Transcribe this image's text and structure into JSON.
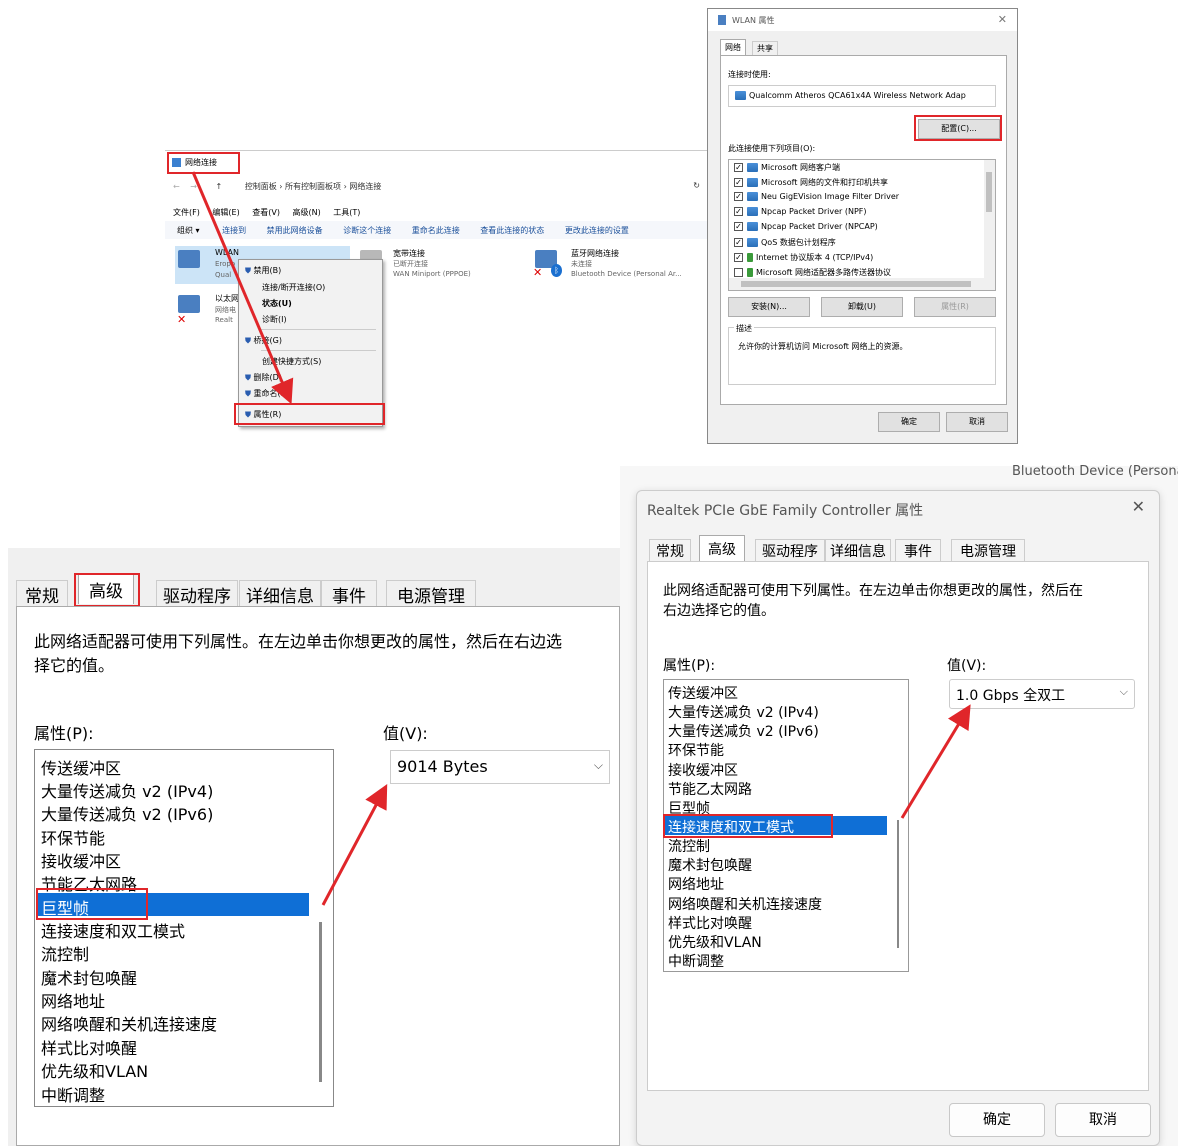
{
  "explorer": {
    "title": "网络连接",
    "breadcrumb": [
      "控制面板",
      "所有控制面板项",
      "网络连接"
    ],
    "menu": [
      "文件(F)",
      "编辑(E)",
      "查看(V)",
      "高级(N)",
      "工具(T)"
    ],
    "toolbar": [
      "组织 ▾",
      "连接到",
      "禁用此网络设备",
      "诊断这个连接",
      "重命名此连接",
      "查看此连接的状态",
      "更改此连接的设置"
    ],
    "adapters": [
      {
        "name": "WLAN",
        "status": "Eropo",
        "device": "Qual"
      },
      {
        "name": "宽带连接",
        "status": "已断开连接",
        "device": "WAN Miniport (PPPOE)"
      },
      {
        "name": "蓝牙网络连接",
        "status": "未连接",
        "device": "Bluetooth Device (Personal Ar..."
      },
      {
        "name": "以太网",
        "status": "网络电",
        "device": "Realt"
      }
    ],
    "context_menu": [
      "禁用(B)",
      "连接/断开连接(O)",
      "状态(U)",
      "诊断(I)",
      "桥接(G)",
      "创建快捷方式(S)",
      "删除(D)",
      "重命名(M)",
      "属性(R)"
    ]
  },
  "wlan": {
    "title": "WLAN 属性",
    "tabs": [
      "网络",
      "共享"
    ],
    "connect_using_label": "连接时使用:",
    "adapter": "Qualcomm Atheros QCA61x4A Wireless Network Adap",
    "configure": "配置(C)...",
    "items_label": "此连接使用下列项目(O):",
    "items": [
      "Microsoft 网络客户端",
      "Microsoft 网络的文件和打印机共享",
      "Neu GigEVision Image Filter Driver",
      "Npcap Packet Driver (NPF)",
      "Npcap Packet Driver (NPCAP)",
      "QoS 数据包计划程序",
      "Internet 协议版本 4 (TCP/IPv4)",
      "Microsoft 网络适配器多路传送器协议"
    ],
    "install": "安装(N)...",
    "uninstall": "卸载(U)",
    "properties": "属性(R)",
    "desc_label": "描述",
    "desc": "允许你的计算机访问 Microsoft 网络上的资源。",
    "ok": "确定",
    "cancel": "取消"
  },
  "adv_left": {
    "tabs": [
      "常规",
      "高级",
      "驱动程序",
      "详细信息",
      "事件",
      "电源管理"
    ],
    "intro": "此网络适配器可使用下列属性。在左边单击你想更改的属性，然后在右边选择它的值。",
    "prop_label": "属性(P):",
    "value_label": "值(V):",
    "value": "9014 Bytes",
    "props": [
      "传送缓冲区",
      "大量传送减负 v2 (IPv4)",
      "大量传送减负 v2 (IPv6)",
      "环保节能",
      "接收缓冲区",
      "节能乙太网路",
      "巨型帧",
      "连接速度和双工模式",
      "流控制",
      "魔术封包唤醒",
      "网络地址",
      "网络唤醒和关机连接速度",
      "样式比对唤醒",
      "优先级和VLAN",
      "中断调整"
    ]
  },
  "adv_right": {
    "title": "Realtek PCIe GbE Family Controller 属性",
    "behind_text": "Bluetooth Device (Persona",
    "tabs": [
      "常规",
      "高级",
      "驱动程序",
      "详细信息",
      "事件",
      "电源管理"
    ],
    "intro": "此网络适配器可使用下列属性。在左边单击你想更改的属性，然后在右边选择它的值。",
    "prop_label": "属性(P):",
    "value_label": "值(V):",
    "value": "1.0 Gbps 全双工",
    "props": [
      "传送缓冲区",
      "大量传送减负 v2 (IPv4)",
      "大量传送减负 v2 (IPv6)",
      "环保节能",
      "接收缓冲区",
      "节能乙太网路",
      "巨型帧",
      "连接速度和双工模式",
      "流控制",
      "魔术封包唤醒",
      "网络地址",
      "网络唤醒和关机连接速度",
      "样式比对唤醒",
      "优先级和VLAN",
      "中断调整"
    ],
    "ok": "确定",
    "cancel": "取消"
  },
  "colors": {
    "highlight": "#0f6fd6",
    "annotation": "#e0262a"
  }
}
